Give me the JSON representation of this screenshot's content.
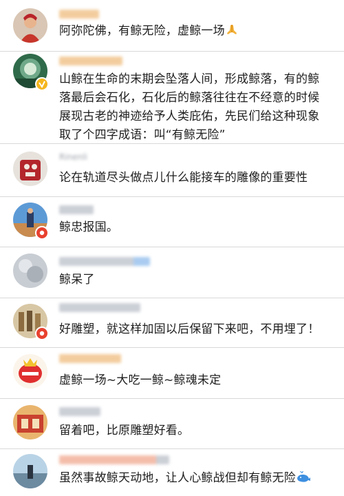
{
  "comments": [
    {
      "username": "@___",
      "text": "阿弥陀佛，有鲸无险，虚鲸一场",
      "emoji": "pray-hands",
      "badge": "none"
    },
    {
      "username": "________",
      "text": "山鲸在生命的末期会坠落人间，形成鲸落，有的鲸落最后会石化，石化后的鲸落往往在不经意的时候展现古老的神迹给予人类庇佑，先民们给这种现象取了个四字成语：叫“有鲸无险”",
      "badge": "gold"
    },
    {
      "username": "Rinenli",
      "text": "论在轨道尽头做点儿什么能接车的雕像的重要性",
      "badge": "none"
    },
    {
      "username": "___",
      "text": "鲸忠报国。",
      "badge": "red"
    },
    {
      "username": "___ winkeleen",
      "text": "鲸呆了",
      "badge": "none"
    },
    {
      "username": "___ __ ____",
      "text": "好雕塑，就这样加固以后保留下来吧，不用埋了！",
      "badge": "red"
    },
    {
      "username": "____",
      "text": "虚鲸一场~大吃一鲸~鲸魂未定",
      "badge": "none"
    },
    {
      "username": "____",
      "text": "留着吧，比原雕塑好看。",
      "badge": "none"
    },
    {
      "username": "Nanmheartedness",
      "text": "虽然事故鲸天动地，让人心鲸战但却有鲸无险",
      "emoji": "whale",
      "badge": "none"
    }
  ],
  "colors": {
    "divider": "#d8d8d8",
    "text": "#1e1e1e",
    "gold_badge": "#f5b61d",
    "red_badge": "#e8412f"
  }
}
